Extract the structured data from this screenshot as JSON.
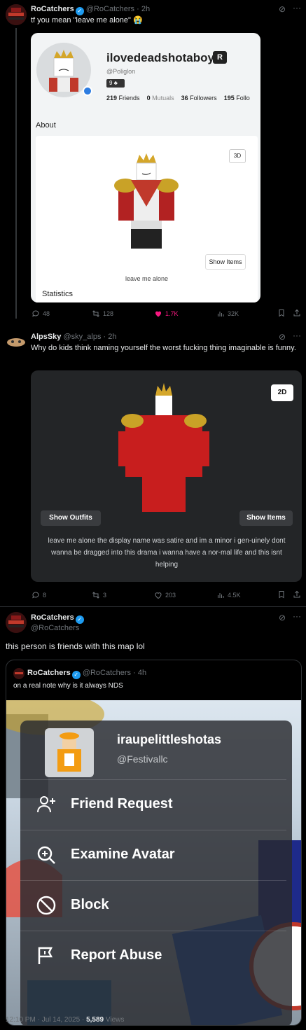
{
  "tweet1": {
    "name": "RoCatchers",
    "handle": "@RoCatchers",
    "time": "· 2h",
    "text": "tf you mean \"leave me alone\" 😭",
    "card": {
      "username": "ilovedeadshotaboys",
      "handle": "@Poliglon",
      "badge_count": "9",
      "stats": [
        {
          "value": "219",
          "label": "Friends"
        },
        {
          "value": "0",
          "label": "Mutuals"
        },
        {
          "value": "36",
          "label": "Followers"
        },
        {
          "value": "195",
          "label": "Follo"
        }
      ],
      "about_label": "About",
      "toggle_label": "3D",
      "show_items_label": "Show Items",
      "caption": "leave me alone",
      "statistics_label": "Statistics"
    },
    "actions": {
      "replies": "48",
      "reposts": "128",
      "likes": "1.7K",
      "views": "32K"
    }
  },
  "tweet2": {
    "name": "AlpsSky",
    "handle": "@sky_alps",
    "time": "· 2h",
    "text": "Why do kids think naming yourself the worst fucking thing imaginable is funny.",
    "card": {
      "toggle_label": "2D",
      "show_outfits_label": "Show Outfits",
      "show_items_label": "Show Items",
      "description": "leave me alone the display name was satire and im a minor i gen-uinely dont wanna be dragged into this drama i wanna have a nor-mal life and this isnt helping"
    },
    "actions": {
      "replies": "8",
      "reposts": "3",
      "likes": "203",
      "views": "4.5K"
    }
  },
  "main_tweet": {
    "name": "RoCatchers",
    "handle": "@RoCatchers",
    "text": "this person is friends with this map lol",
    "quote": {
      "name": "RoCatchers",
      "handle": "@RoCatchers",
      "time": "· 4h",
      "text": "on a real note why is it always NDS",
      "menu": {
        "username": "iraupelittleshotas",
        "handle": "@Festivallc",
        "items": [
          {
            "label": "Friend Request",
            "icon": "add-friend-icon"
          },
          {
            "label": "Examine Avatar",
            "icon": "magnify-icon"
          },
          {
            "label": "Block",
            "icon": "block-icon"
          },
          {
            "label": "Report Abuse",
            "icon": "flag-icon"
          }
        ]
      }
    },
    "timestamp": "12:10 PM · Jul 14, 2025 ·",
    "views_count": "5,589",
    "views_label": "Views"
  },
  "colors": {
    "accent": "#1d9bf0",
    "like": "#f91880",
    "muted": "#71767b",
    "bg": "#000000"
  }
}
